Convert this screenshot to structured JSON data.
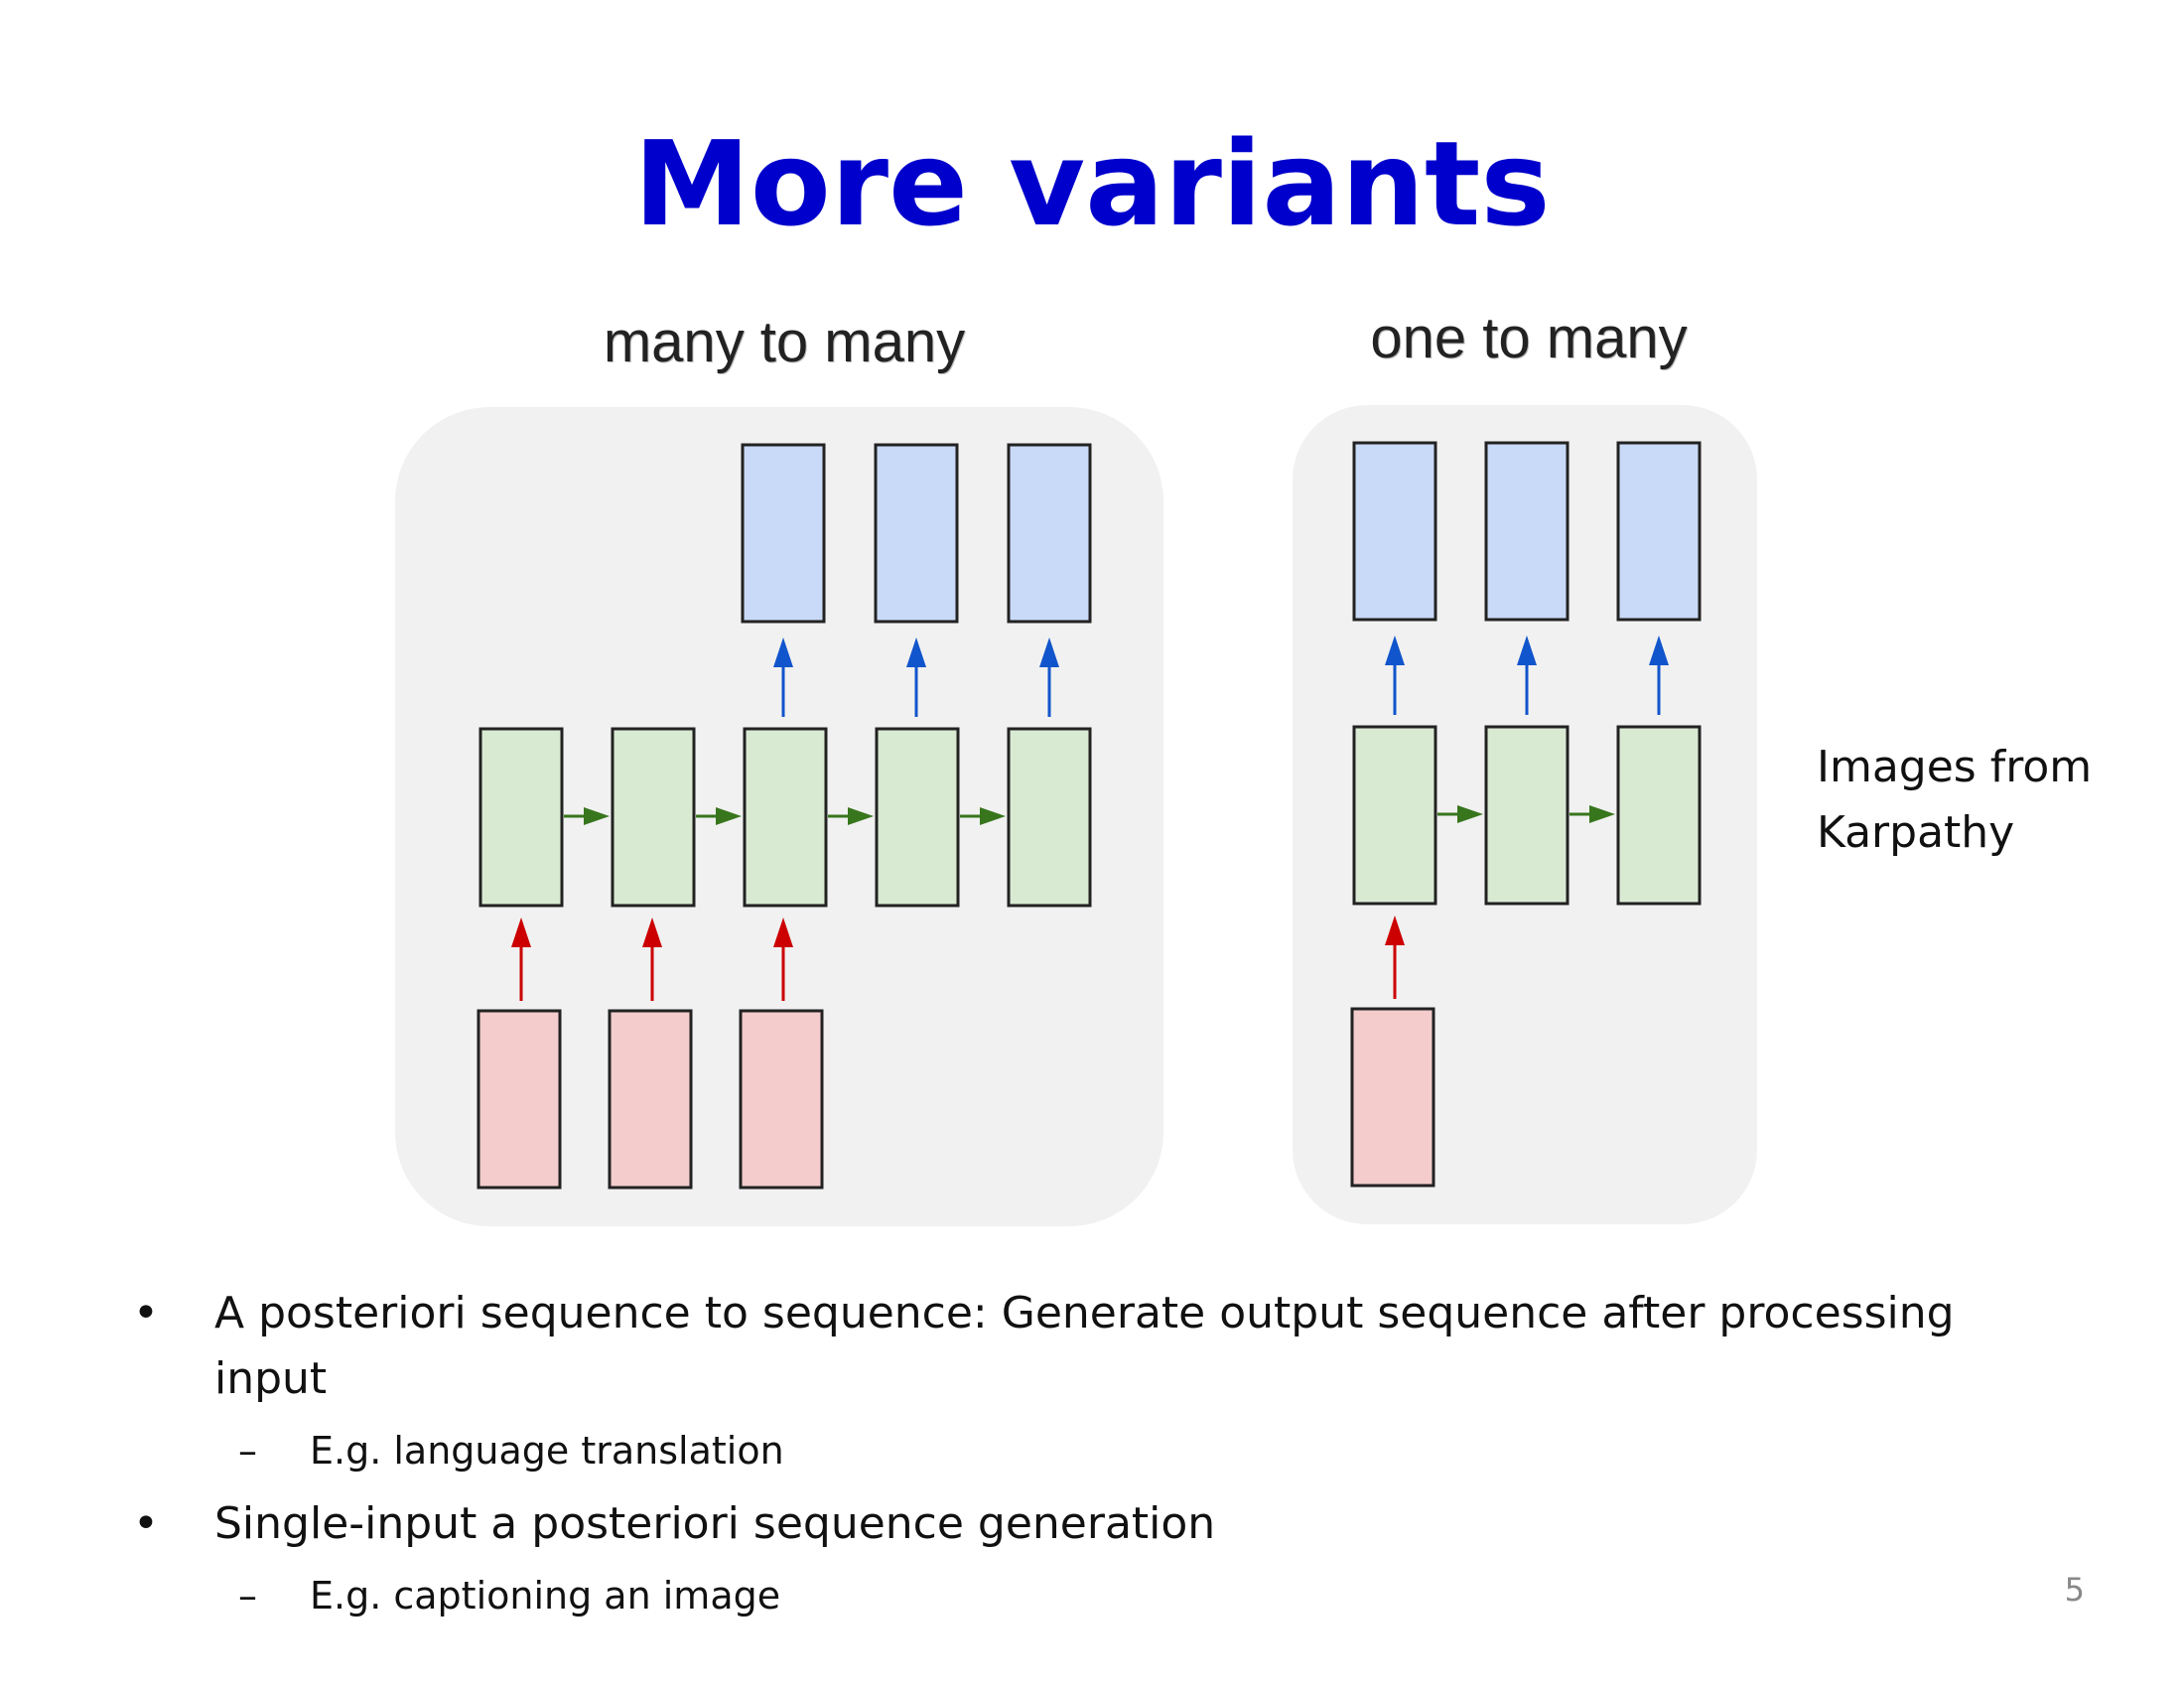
{
  "slide": {
    "title": "More variants",
    "page_number": "5"
  },
  "diagrams": [
    {
      "label": "many to many",
      "input_count": 3,
      "hidden_count": 5,
      "output_count": 3
    },
    {
      "label": "one to many",
      "input_count": 1,
      "hidden_count": 3,
      "output_count": 3
    }
  ],
  "side_note": {
    "line1": "Images from",
    "line2": "Karpathy"
  },
  "bullets": [
    {
      "text": "A posteriori sequence to sequence:  Generate output sequence after processing input",
      "sub": "E.g. language translation"
    },
    {
      "text": "Single-input a posteriori sequence generation",
      "sub": "E.g. captioning an image"
    }
  ],
  "symbols": {
    "bullet": "•",
    "dash": "–"
  },
  "colors": {
    "title": "#0000cc",
    "panel_bg": "#f1f1f1",
    "input_fill": "#f4cccc",
    "hidden_fill": "#d9ead3",
    "output_fill": "#c9daf8",
    "input_arrow": "#cc0000",
    "recurrent_arrow": "#38761d",
    "output_arrow": "#1155cc"
  }
}
